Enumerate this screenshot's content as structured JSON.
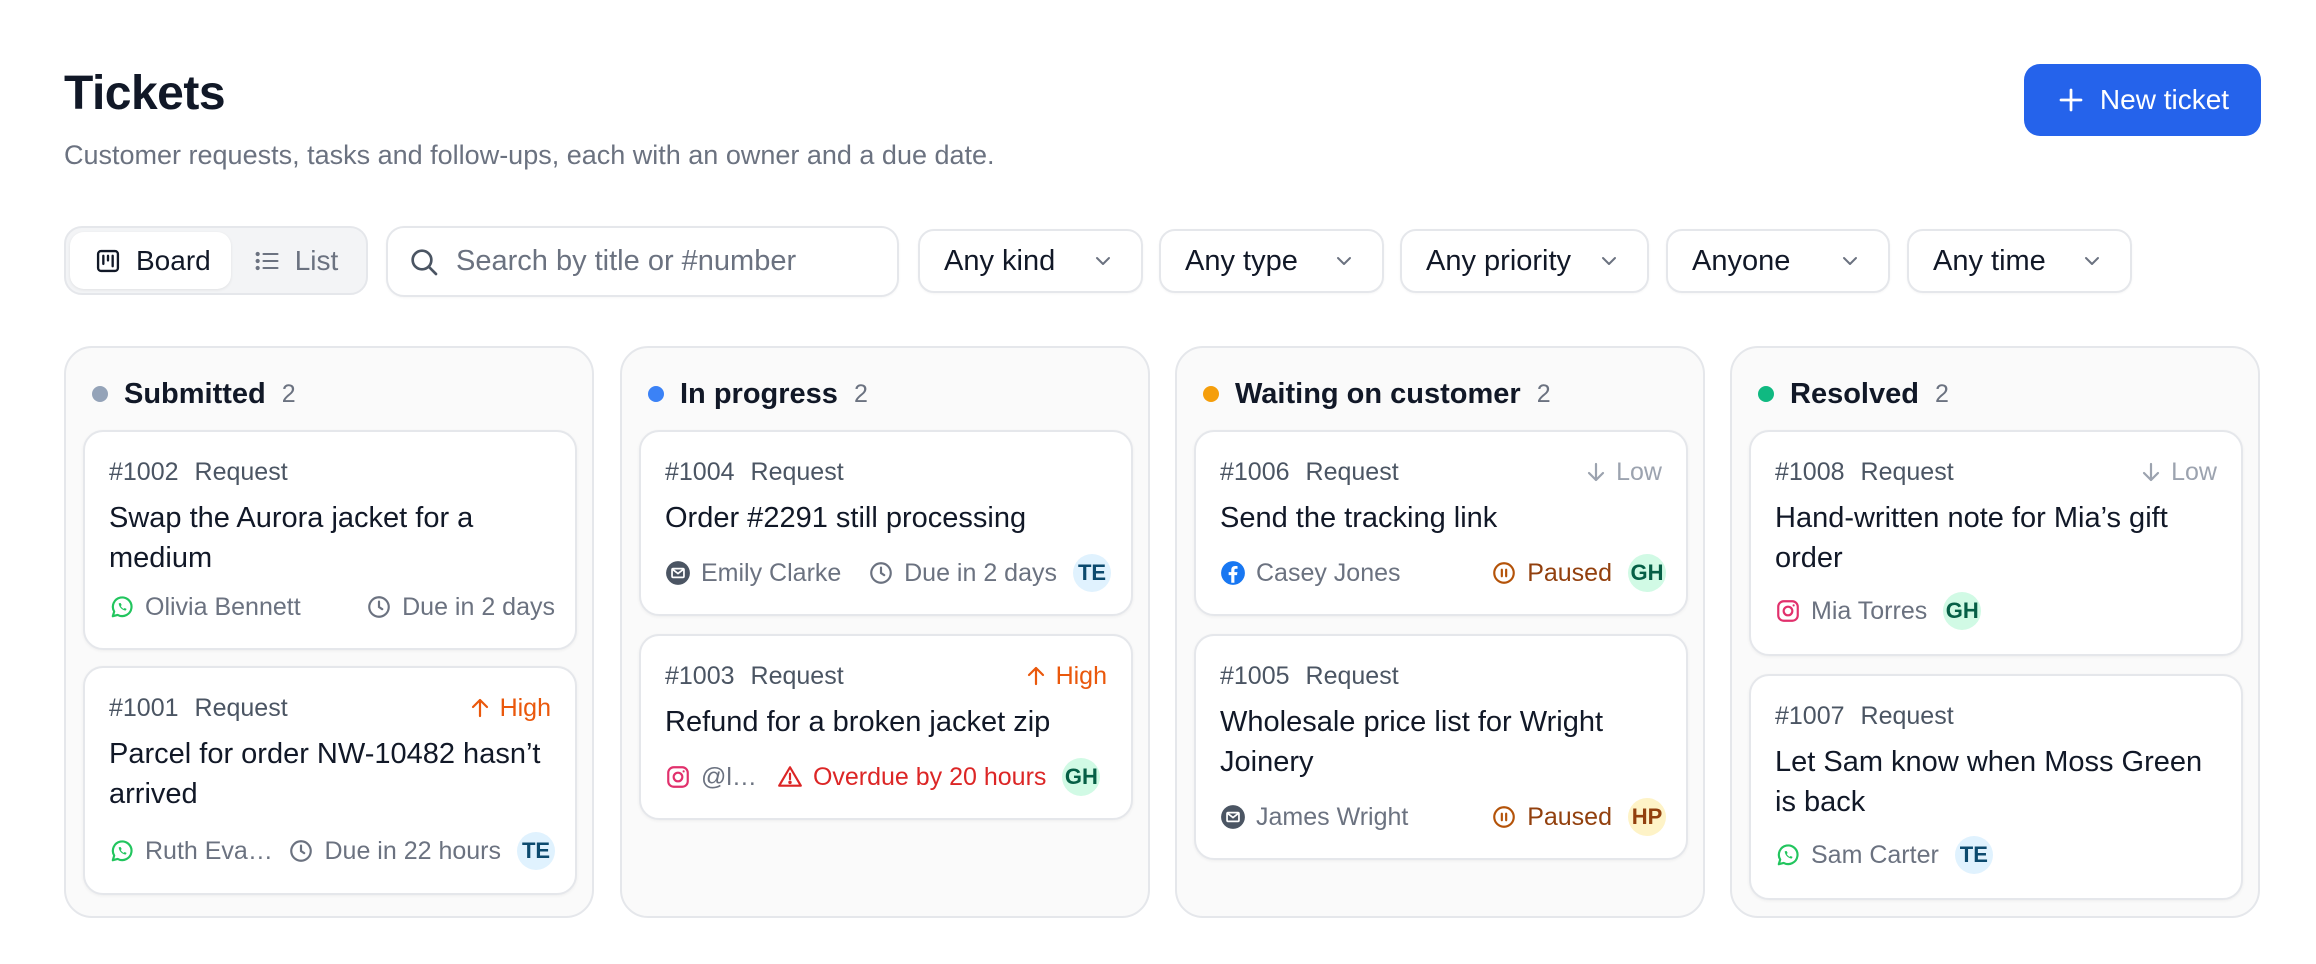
{
  "header": {
    "title": "Tickets",
    "subtitle": "Customer requests, tasks and follow-ups, each with an owner and a due date.",
    "new_button": "New ticket"
  },
  "toolbar": {
    "views": [
      {
        "label": "Board",
        "icon": "board-icon",
        "active": true
      },
      {
        "label": "List",
        "icon": "list-icon",
        "active": false
      }
    ],
    "search_placeholder": "Search by title or #number",
    "filters": [
      "Any kind",
      "Any type",
      "Any priority",
      "Anyone",
      "Any time"
    ]
  },
  "colors": {
    "accent": "#2563eb",
    "submitted": "#94a3b8",
    "in_progress": "#3b82f6",
    "waiting": "#f59e0b",
    "resolved": "#10b981",
    "high": "#ea580c",
    "overdue": "#dc2626",
    "paused": "#92400e"
  },
  "columns": [
    {
      "title": "Submitted",
      "count": "2",
      "cards": [
        {
          "num": "#1002",
          "type": "Request",
          "priority": "",
          "title": "Swap the Aurora jacket for a medium",
          "contact_icon": "whatsapp-icon",
          "contact": "Olivia Bennett",
          "due_icon": "clock-icon",
          "due": "Due in 2 days",
          "avatar": ""
        },
        {
          "num": "#1001",
          "type": "Request",
          "priority": "High",
          "title": "Parcel for order NW-10482 hasn’t arrived",
          "contact_icon": "whatsapp-icon",
          "contact": "Ruth Eva…",
          "due_icon": "clock-icon",
          "due": "Due in 22 hours",
          "avatar": "TE"
        }
      ]
    },
    {
      "title": "In progress",
      "count": "2",
      "cards": [
        {
          "num": "#1004",
          "type": "Request",
          "priority": "",
          "title": "Order #2291 still processing",
          "contact_icon": "email-icon",
          "contact": "Emily Clarke",
          "due_icon": "clock-icon",
          "due": "Due in 2 days",
          "avatar": "TE"
        },
        {
          "num": "#1003",
          "type": "Request",
          "priority": "High",
          "title": "Refund for a broken jacket zip",
          "contact_icon": "instagram-icon",
          "contact": "@l…",
          "due_icon": "warning-icon",
          "due": "Overdue by 20 hours",
          "avatar": "GH"
        }
      ]
    },
    {
      "title": "Waiting on customer",
      "count": "2",
      "cards": [
        {
          "num": "#1006",
          "type": "Request",
          "priority": "Low",
          "title": "Send the tracking link",
          "contact_icon": "facebook-icon",
          "contact": "Casey Jones",
          "due_icon": "pause-icon",
          "due": "Paused",
          "avatar": "GH"
        },
        {
          "num": "#1005",
          "type": "Request",
          "priority": "",
          "title": "Wholesale price list for Wright Joinery",
          "contact_icon": "email-icon",
          "contact": "James Wright",
          "due_icon": "pause-icon",
          "due": "Paused",
          "avatar": "HP"
        }
      ]
    },
    {
      "title": "Resolved",
      "count": "2",
      "cards": [
        {
          "num": "#1008",
          "type": "Request",
          "priority": "Low",
          "title": "Hand-written note for Mia’s gift order",
          "contact_icon": "instagram-icon",
          "contact": "Mia Torres",
          "due_icon": "",
          "due": "",
          "avatar": "GH"
        },
        {
          "num": "#1007",
          "type": "Request",
          "priority": "",
          "title": "Let Sam know when Moss Green is back",
          "contact_icon": "whatsapp-icon",
          "contact": "Sam Carter",
          "due_icon": "",
          "due": "",
          "avatar": "TE"
        }
      ]
    }
  ]
}
